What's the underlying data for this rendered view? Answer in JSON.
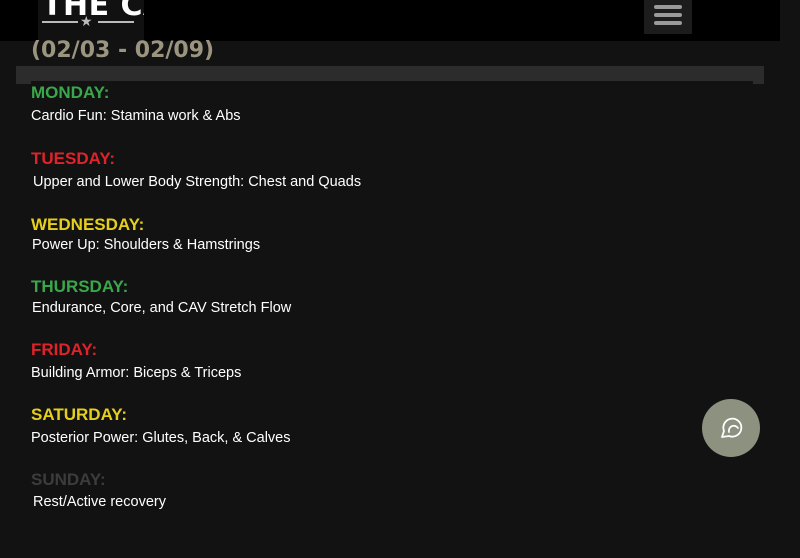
{
  "header": {
    "logo_text": "THE CAV",
    "menu_icon": "hamburger-menu-icon"
  },
  "schedule": {
    "date_range": "(02/03 - 02/09)",
    "days": [
      {
        "label": "MONDAY:",
        "description": "Cardio Fun: Stamina work & Abs",
        "color": "#3aa84a"
      },
      {
        "label": "TUESDAY:",
        "description": "Upper and Lower Body Strength: Chest and Quads",
        "color": "#e0222a"
      },
      {
        "label": "WEDNESDAY:",
        "description": "Power Up: Shoulders & Hamstrings",
        "color": "#e6cf1c"
      },
      {
        "label": "THURSDAY:",
        "description": "Endurance, Core, and CAV Stretch Flow",
        "color": "#3aa84a"
      },
      {
        "label": "FRIDAY:",
        "description": "Building Armor: Biceps & Triceps",
        "color": "#e0222a"
      },
      {
        "label": "SATURDAY:",
        "description": "Posterior Power: Glutes, Back, & Calves",
        "color": "#e6cf1c"
      },
      {
        "label": "SUNDAY:",
        "description": "Rest/Active recovery",
        "color": "#3c3c3c"
      }
    ]
  },
  "chat": {
    "icon": "chat-bubble-icon",
    "background": "#8c9180"
  }
}
